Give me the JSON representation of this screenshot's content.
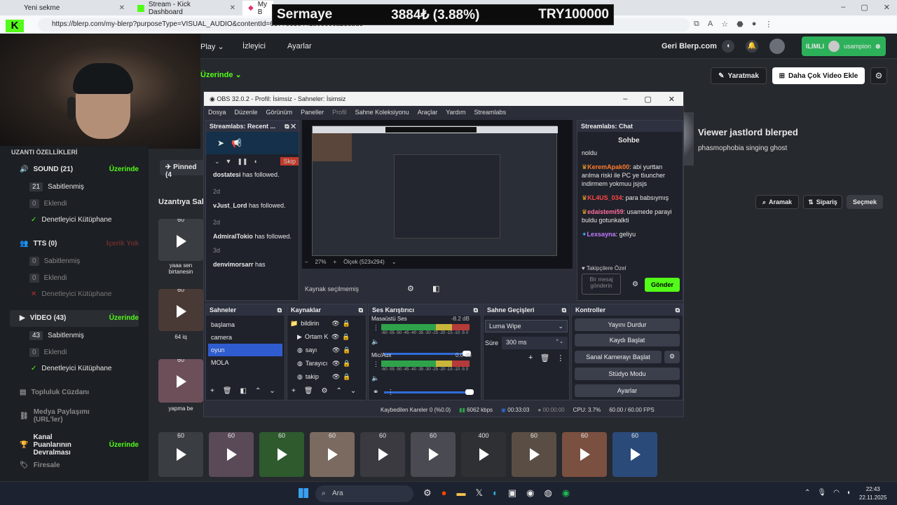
{
  "browser": {
    "tabs": [
      {
        "label": "Yeni sekme"
      },
      {
        "label": "Stream - Kick Dashboard"
      },
      {
        "label": "My B"
      }
    ],
    "url": "https://blerp.com/my-blerp?purposeType=VISUAL_AUDIO&contentId=6877e63e441b0900ca23bbdc"
  },
  "ticker": {
    "name": "Sermaye",
    "value": "3884₺ (3.88%)",
    "goal": "TRY100000"
  },
  "site_nav": {
    "items": [
      "Play",
      "İzleyici",
      "Ayarlar"
    ],
    "back_link": "Geri Blerp.com",
    "mode_badge": "ILIMLI",
    "username": "usampion",
    "on_dropdown": "Üzerinde",
    "create_button": "Yaratmak",
    "add_video_button": "Daha Çok Video Ekle"
  },
  "sidebar": {
    "heading": "UZANTI ÖZELLİKLERİ",
    "sections": [
      {
        "title": "SOUND (21)",
        "status": "Üzerinde",
        "rows": [
          {
            "count": "21",
            "label": "Sabitlenmiş"
          },
          {
            "count": "0",
            "label": "Eklendi"
          },
          {
            "count": "",
            "label": "Denetleyici Kütüphane"
          }
        ]
      },
      {
        "title": "TTS (0)",
        "status": "İçerik Yok",
        "rows": [
          {
            "count": "0",
            "label": "Sabitlenmiş"
          },
          {
            "count": "0",
            "label": "Eklendi"
          },
          {
            "count": "",
            "label": "Denetleyici Kütüphane"
          }
        ]
      },
      {
        "title": "VİDEO (43)",
        "status": "Üzerinde",
        "rows": [
          {
            "count": "43",
            "label": "Sabitlenmiş"
          },
          {
            "count": "0",
            "label": "Eklendi"
          },
          {
            "count": "",
            "label": "Denetleyici Kütüphane"
          }
        ]
      }
    ],
    "extra": [
      {
        "label": "Topluluk Cüzdanı",
        "status": ""
      },
      {
        "label": "Medya Paylaşımı (URL'ler)",
        "status": ""
      },
      {
        "label": "Kanal Puanlarının Devralması",
        "status": "Üzerinde"
      },
      {
        "label": "Firesale",
        "status": ""
      }
    ]
  },
  "content": {
    "pinned_tab": "Pinned (4",
    "section_title": "Uzantıya Sab",
    "search_button": "Aramak",
    "order_button": "Sipariş",
    "select_button": "Seçmek",
    "left_cards": [
      {
        "count": "60",
        "caption": "yaaa sen birtanesin"
      },
      {
        "count": "60",
        "caption": "64 iq"
      },
      {
        "count": "60",
        "caption": "yapma be"
      }
    ],
    "row_counts": [
      "60",
      "60",
      "60",
      "60",
      "60",
      "60",
      "400",
      "60",
      "60",
      "60"
    ]
  },
  "viewer_notice": {
    "title": "Viewer jastlord blerped",
    "subtitle": "phasmophobia singing ghost"
  },
  "obs": {
    "title": "OBS 32.0.2 - Profil: İsimsiz - Sahneler: İsimsiz",
    "menu": [
      "Dosya",
      "Düzenle",
      "Görünüm",
      "Paneller",
      "Profil",
      "Sahne Koleksiyonu",
      "Araçlar",
      "Yardım",
      "Streamlabs"
    ],
    "recent": {
      "title": "Streamlabs: Recent ...",
      "skip": "Skip",
      "events": [
        {
          "user": "dostatesi",
          "text": "has followed.",
          "age": "2d"
        },
        {
          "user": "vJust_Lord",
          "text": "has followed.",
          "age": "2d"
        },
        {
          "user": "AdmiralTokio",
          "text": "has followed.",
          "age": "3d"
        },
        {
          "user": "denvimorsarr",
          "text": "has",
          "age": ""
        }
      ]
    },
    "preview": {
      "zoom": "27%",
      "scale": "Ölçek (523x294)",
      "no_source": "Kaynak seçilmemiş"
    },
    "chat": {
      "title": "Streamlabs: Chat",
      "partial": "Sohbe",
      "messages": [
        {
          "user": "",
          "text": "noldu",
          "color": "#e8e8e8"
        },
        {
          "user": "KeremApak00",
          "text": ": abi yurttan arılma riski ile PC ye tlıuncher indirmem yokmuu jsjsjs",
          "color": "#ff7b2e"
        },
        {
          "user": "KL4US_034",
          "text": ": para babsıymış",
          "color": "#ff4545"
        },
        {
          "user": "edaistemi59",
          "text": ": usamede parayi buldu gotunkalkti",
          "color": "#ff6b9a"
        },
        {
          "user": "Lexsayna",
          "text": ": geliyu",
          "color": "#c27bff"
        }
      ],
      "followers_only": "Takipçilere Özel",
      "input_placeholder": "Bir mesaj gönderin",
      "send": "Gönder"
    },
    "scenes": {
      "title": "Sahneler",
      "items": [
        "başlama",
        "camera",
        "oyun",
        "MOLA"
      ],
      "selected": "oyun"
    },
    "sources": {
      "title": "Kaynaklar",
      "items": [
        "bildirin",
        "Ortam K",
        "sayı",
        "Tarayıcı",
        "takip"
      ]
    },
    "mixer": {
      "title": "Ses Karıştırıcı",
      "channels": [
        {
          "name": "Masaüstü Ses",
          "db": "-8.2 dB",
          "level": 0.62
        },
        {
          "name": "Mic/Aux",
          "db": "0.0 dB",
          "level": 0.58
        }
      ],
      "scale": "-60 -55 -50 -45 -40 -35 -30 -25 -20 -15 -10 -5 0"
    },
    "transitions": {
      "title": "Sahne Geçişleri",
      "type": "Luma Wipe",
      "duration_label": "Süre",
      "duration": "300 ms"
    },
    "controls": {
      "title": "Kontroller",
      "buttons": [
        "Yayını Durdur",
        "Kaydı Başlat",
        "Sanal Kamerayı Başlat",
        "Stüdyo Modu",
        "Ayarlar"
      ]
    },
    "status": {
      "dropped": "Kaybedilen Kareler 0 (%0.0)",
      "kbps": "6062 kbps",
      "live": "00:33:03",
      "rec": "00:00:00",
      "cpu": "CPU: 3.7%",
      "fps": "60.00 / 60.00 FPS"
    }
  },
  "taskbar": {
    "search": "Ara",
    "time": "22:43",
    "date": "22.11.2025"
  }
}
